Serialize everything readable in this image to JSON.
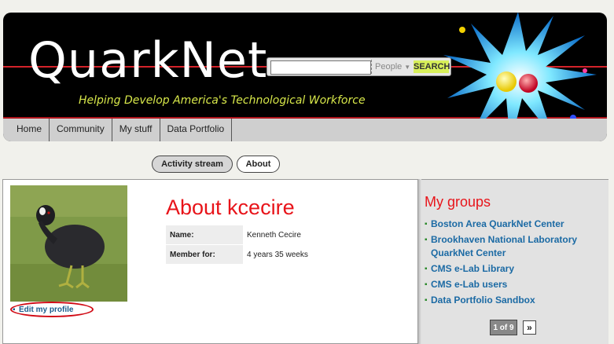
{
  "header": {
    "logo": "QuarkNet",
    "tagline": "Helping Develop America's Technological Workforce",
    "search": {
      "value": "",
      "placeholder": "",
      "scope": "People",
      "button_label": "SEARCH"
    }
  },
  "nav": {
    "items": [
      {
        "label": "Home"
      },
      {
        "label": "Community"
      },
      {
        "label": "My stuff"
      },
      {
        "label": "Data Portfolio"
      }
    ]
  },
  "tabs": [
    {
      "label": "Activity stream",
      "active": true
    },
    {
      "label": "About",
      "active": false
    }
  ],
  "profile": {
    "title": "About kcecire",
    "edit_link": "Edit my profile",
    "fields": [
      {
        "label": "Name:",
        "value": "Kenneth Cecire"
      },
      {
        "label": "Member for:",
        "value": "4 years 35 weeks"
      }
    ]
  },
  "sidebar": {
    "title": "My groups",
    "groups": [
      "Boston Area QuarkNet Center",
      "Brookhaven National Laboratory QuarkNet Center",
      "CMS e-Lab Library",
      "CMS e-Lab users",
      "Data Portfolio Sandbox"
    ],
    "pager": {
      "current": "1 of 9",
      "next": "»"
    }
  },
  "colors": {
    "accent_red": "#e8141a",
    "link_blue": "#1b6aa4",
    "tagline_yellow": "#d8e84a",
    "search_button": "#d8f05a"
  }
}
